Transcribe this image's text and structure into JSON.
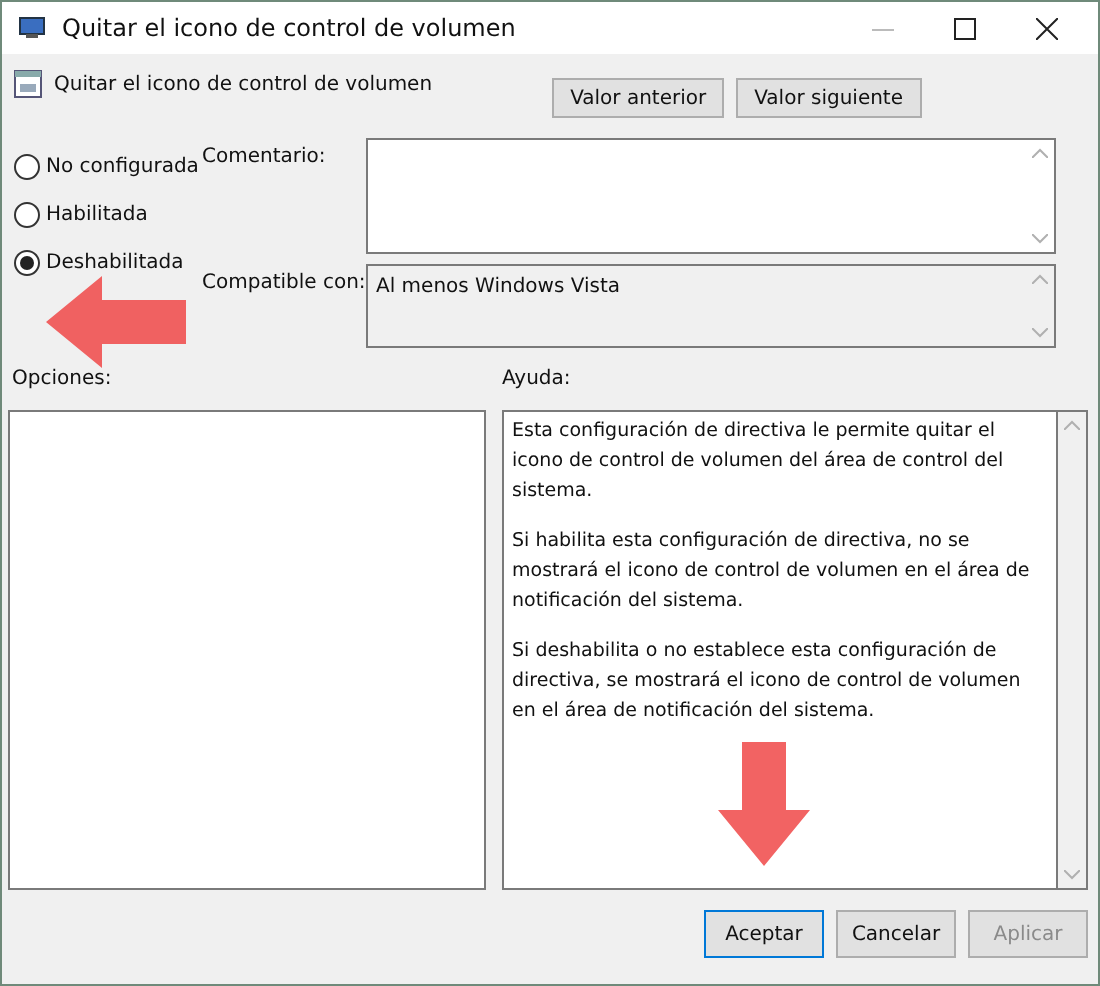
{
  "window": {
    "title": "Quitar el icono de control de volumen"
  },
  "policy_title": "Quitar el icono de control de volumen",
  "nav_buttons": [
    {
      "label": "Valor anterior"
    },
    {
      "label": "Valor siguiente"
    }
  ],
  "state_options": [
    {
      "label": "No configurada",
      "selected": false
    },
    {
      "label": "Habilitada",
      "selected": false
    },
    {
      "label": "Deshabilitada",
      "selected": true
    }
  ],
  "comment": {
    "label": "Comentario:"
  },
  "compatible": {
    "label": "Compatible con:",
    "value": "Al menos Windows Vista"
  },
  "options": {
    "label": "Opciones:"
  },
  "help": {
    "label": "Ayuda:",
    "paragraphs": [
      "Esta configuración de directiva le permite quitar el icono de control de volumen del área de control del sistema.",
      "Si habilita esta configuración de directiva, no se mostrará el icono de control de volumen en el área de notificación del sistema.",
      "Si deshabilita o no establece esta configuración de directiva, se mostrará el icono de control de volumen en el área de notificación del sistema."
    ]
  },
  "buttons": [
    {
      "label": "Aceptar",
      "focused": true,
      "disabled": false
    },
    {
      "label": "Cancelar",
      "focused": false,
      "disabled": false
    },
    {
      "label": "Aplicar",
      "focused": false,
      "disabled": true
    }
  ]
}
